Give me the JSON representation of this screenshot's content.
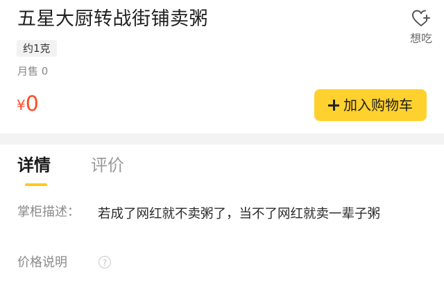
{
  "product": {
    "title": "五星大厨转战街铺卖粥",
    "spec_tag": "约1克",
    "monthly_sales": "月售 0",
    "price_currency": "¥",
    "price_value": "0"
  },
  "want_button": {
    "label": "想吃",
    "icon": "heart-plus-icon"
  },
  "cart_button": {
    "label": "加入购物车",
    "icon": "plus-icon",
    "color": "#ffd12e"
  },
  "tabs": [
    {
      "label": "详情",
      "active": true
    },
    {
      "label": "评价",
      "active": false
    }
  ],
  "details": {
    "description_label": "掌柜描述：",
    "description_text": "若成了网红就不卖粥了，当不了网红就卖一辈子粥",
    "price_note_label": "价格说明",
    "help_icon": "?"
  },
  "colors": {
    "price": "#ff4a26",
    "accent": "#ffc81e"
  }
}
